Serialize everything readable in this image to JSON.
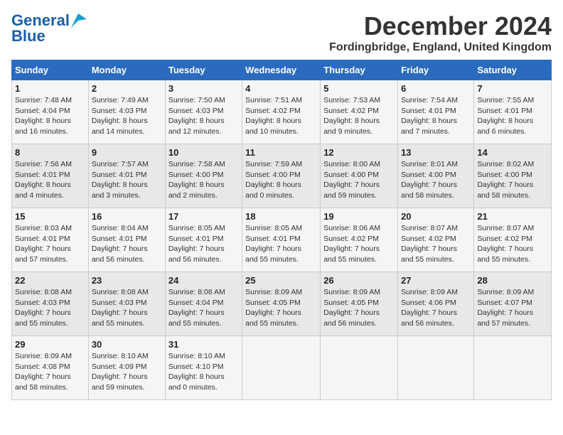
{
  "header": {
    "logo_line1": "General",
    "logo_line2": "Blue",
    "month": "December 2024",
    "location": "Fordingbridge, England, United Kingdom"
  },
  "weekdays": [
    "Sunday",
    "Monday",
    "Tuesday",
    "Wednesday",
    "Thursday",
    "Friday",
    "Saturday"
  ],
  "weeks": [
    [
      {
        "day": "1",
        "info": "Sunrise: 7:48 AM\nSunset: 4:04 PM\nDaylight: 8 hours\nand 16 minutes."
      },
      {
        "day": "2",
        "info": "Sunrise: 7:49 AM\nSunset: 4:03 PM\nDaylight: 8 hours\nand 14 minutes."
      },
      {
        "day": "3",
        "info": "Sunrise: 7:50 AM\nSunset: 4:03 PM\nDaylight: 8 hours\nand 12 minutes."
      },
      {
        "day": "4",
        "info": "Sunrise: 7:51 AM\nSunset: 4:02 PM\nDaylight: 8 hours\nand 10 minutes."
      },
      {
        "day": "5",
        "info": "Sunrise: 7:53 AM\nSunset: 4:02 PM\nDaylight: 8 hours\nand 9 minutes."
      },
      {
        "day": "6",
        "info": "Sunrise: 7:54 AM\nSunset: 4:01 PM\nDaylight: 8 hours\nand 7 minutes."
      },
      {
        "day": "7",
        "info": "Sunrise: 7:55 AM\nSunset: 4:01 PM\nDaylight: 8 hours\nand 6 minutes."
      }
    ],
    [
      {
        "day": "8",
        "info": "Sunrise: 7:56 AM\nSunset: 4:01 PM\nDaylight: 8 hours\nand 4 minutes."
      },
      {
        "day": "9",
        "info": "Sunrise: 7:57 AM\nSunset: 4:01 PM\nDaylight: 8 hours\nand 3 minutes."
      },
      {
        "day": "10",
        "info": "Sunrise: 7:58 AM\nSunset: 4:00 PM\nDaylight: 8 hours\nand 2 minutes."
      },
      {
        "day": "11",
        "info": "Sunrise: 7:59 AM\nSunset: 4:00 PM\nDaylight: 8 hours\nand 0 minutes."
      },
      {
        "day": "12",
        "info": "Sunrise: 8:00 AM\nSunset: 4:00 PM\nDaylight: 7 hours\nand 59 minutes."
      },
      {
        "day": "13",
        "info": "Sunrise: 8:01 AM\nSunset: 4:00 PM\nDaylight: 7 hours\nand 58 minutes."
      },
      {
        "day": "14",
        "info": "Sunrise: 8:02 AM\nSunset: 4:00 PM\nDaylight: 7 hours\nand 58 minutes."
      }
    ],
    [
      {
        "day": "15",
        "info": "Sunrise: 8:03 AM\nSunset: 4:01 PM\nDaylight: 7 hours\nand 57 minutes."
      },
      {
        "day": "16",
        "info": "Sunrise: 8:04 AM\nSunset: 4:01 PM\nDaylight: 7 hours\nand 56 minutes."
      },
      {
        "day": "17",
        "info": "Sunrise: 8:05 AM\nSunset: 4:01 PM\nDaylight: 7 hours\nand 56 minutes."
      },
      {
        "day": "18",
        "info": "Sunrise: 8:05 AM\nSunset: 4:01 PM\nDaylight: 7 hours\nand 55 minutes."
      },
      {
        "day": "19",
        "info": "Sunrise: 8:06 AM\nSunset: 4:02 PM\nDaylight: 7 hours\nand 55 minutes."
      },
      {
        "day": "20",
        "info": "Sunrise: 8:07 AM\nSunset: 4:02 PM\nDaylight: 7 hours\nand 55 minutes."
      },
      {
        "day": "21",
        "info": "Sunrise: 8:07 AM\nSunset: 4:02 PM\nDaylight: 7 hours\nand 55 minutes."
      }
    ],
    [
      {
        "day": "22",
        "info": "Sunrise: 8:08 AM\nSunset: 4:03 PM\nDaylight: 7 hours\nand 55 minutes."
      },
      {
        "day": "23",
        "info": "Sunrise: 8:08 AM\nSunset: 4:03 PM\nDaylight: 7 hours\nand 55 minutes."
      },
      {
        "day": "24",
        "info": "Sunrise: 8:08 AM\nSunset: 4:04 PM\nDaylight: 7 hours\nand 55 minutes."
      },
      {
        "day": "25",
        "info": "Sunrise: 8:09 AM\nSunset: 4:05 PM\nDaylight: 7 hours\nand 55 minutes."
      },
      {
        "day": "26",
        "info": "Sunrise: 8:09 AM\nSunset: 4:05 PM\nDaylight: 7 hours\nand 56 minutes."
      },
      {
        "day": "27",
        "info": "Sunrise: 8:09 AM\nSunset: 4:06 PM\nDaylight: 7 hours\nand 56 minutes."
      },
      {
        "day": "28",
        "info": "Sunrise: 8:09 AM\nSunset: 4:07 PM\nDaylight: 7 hours\nand 57 minutes."
      }
    ],
    [
      {
        "day": "29",
        "info": "Sunrise: 8:09 AM\nSunset: 4:08 PM\nDaylight: 7 hours\nand 58 minutes."
      },
      {
        "day": "30",
        "info": "Sunrise: 8:10 AM\nSunset: 4:09 PM\nDaylight: 7 hours\nand 59 minutes."
      },
      {
        "day": "31",
        "info": "Sunrise: 8:10 AM\nSunset: 4:10 PM\nDaylight: 8 hours\nand 0 minutes."
      },
      {
        "day": "",
        "info": ""
      },
      {
        "day": "",
        "info": ""
      },
      {
        "day": "",
        "info": ""
      },
      {
        "day": "",
        "info": ""
      }
    ]
  ]
}
